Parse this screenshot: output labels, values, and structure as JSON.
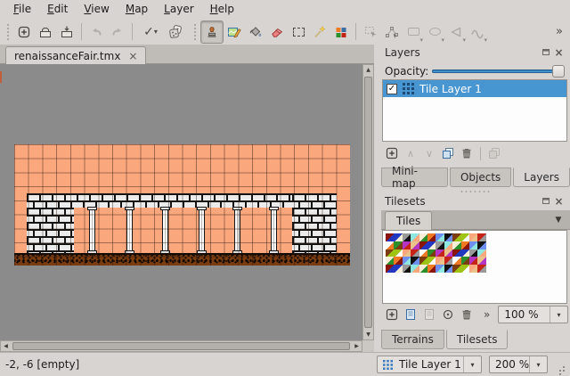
{
  "app": "Tiled map editor",
  "menu_bar": {
    "items": [
      "File",
      "Edit",
      "View",
      "Map",
      "Layer",
      "Help"
    ]
  },
  "toolbar": {
    "file_icons": [
      "new-map-icon",
      "open-icon",
      "save-icon"
    ],
    "history_icons": [
      "undo-icon",
      "redo-icon"
    ],
    "command_icons": [
      "run-command-icon",
      "random-mode-dice-icon"
    ],
    "tool_icons": [
      "stamp-brush-icon",
      "terrain-brush-icon",
      "bucket-fill-icon",
      "eraser-icon",
      "rectangular-select-icon",
      "magic-wand-icon",
      "select-same-tile-icon"
    ],
    "object_tool_icons": [
      "select-objects-icon",
      "edit-polygons-icon",
      "insert-rectangle-icon",
      "insert-ellipse-icon",
      "insert-polygon-icon",
      "insert-polyline-icon"
    ],
    "active_tool": "stamp-brush"
  },
  "glyphs": {
    "check": "✓",
    "dropdown": "▾",
    "dropdown_big": "▼",
    "overflow": "»",
    "close": "×",
    "plus": "+",
    "up": "∧",
    "down": "∨",
    "scroll_up": "▲",
    "scroll_down": "▼",
    "scroll_left": "◀",
    "scroll_right": "▶"
  },
  "document_tab": {
    "title": "renaissanceFair.tmx",
    "close_glyph": "×"
  },
  "layers_panel": {
    "title": "Layers",
    "opacity_label": "Opacity:",
    "opacity_percent": 100,
    "layers": [
      {
        "name": "Tile Layer 1",
        "visible": true,
        "selected": true
      }
    ],
    "button_icons": [
      "add-layer-icon",
      "raise-layer-icon",
      "lower-layer-icon",
      "duplicate-layer-icon",
      "remove-layer-icon",
      "highlight-layer-icon"
    ],
    "dock_tabs": [
      "Mini-map",
      "Objects",
      "Layers"
    ],
    "active_dock_tab": "Layers"
  },
  "tilesets_panel": {
    "title": "Tilesets",
    "tileset_tabs": [
      "Tiles"
    ],
    "active_tileset_tab": "Tiles",
    "button_icons": [
      "new-tileset-icon",
      "import-tileset-icon",
      "export-tileset-icon",
      "tileset-properties-icon",
      "remove-tileset-icon"
    ],
    "zoom_value": "100 %",
    "dock_tabs": [
      "Terrains",
      "Tilesets"
    ],
    "active_dock_tab": "Tilesets"
  },
  "status_bar": {
    "position_text": "-2, -6 [empty]",
    "layer_selector": "Tile Layer 1",
    "zoom_selector": "200 %"
  },
  "map": {
    "background_color": "#fba77d",
    "canvas_color": "#8b8b8b",
    "dirt_color": "#7b3d10",
    "brick_color": "#ebebeb",
    "pillar_count": 6,
    "pillar_lefts": [
      84,
      126,
      166,
      207,
      247,
      288
    ],
    "description": "brick wall band on six pillars over dirt ground"
  },
  "tileset_view": {
    "columns": 12,
    "rows": 5,
    "palette": [
      "#111111",
      "#ffffff",
      "#2238c0",
      "#6e8ef0",
      "#c52318",
      "#8a1505",
      "#ef7a23",
      "#fba77d",
      "#e9c389",
      "#f6eed6",
      "#9fc414",
      "#b434c4",
      "#8fe8e0",
      "#7b3d10",
      "#2a8f2a",
      "#9a9a9a"
    ]
  },
  "colors": {
    "selection_blue": "#4795d1",
    "slider_blue": "#3d85c6",
    "window_bg": "#d8d4d1"
  }
}
